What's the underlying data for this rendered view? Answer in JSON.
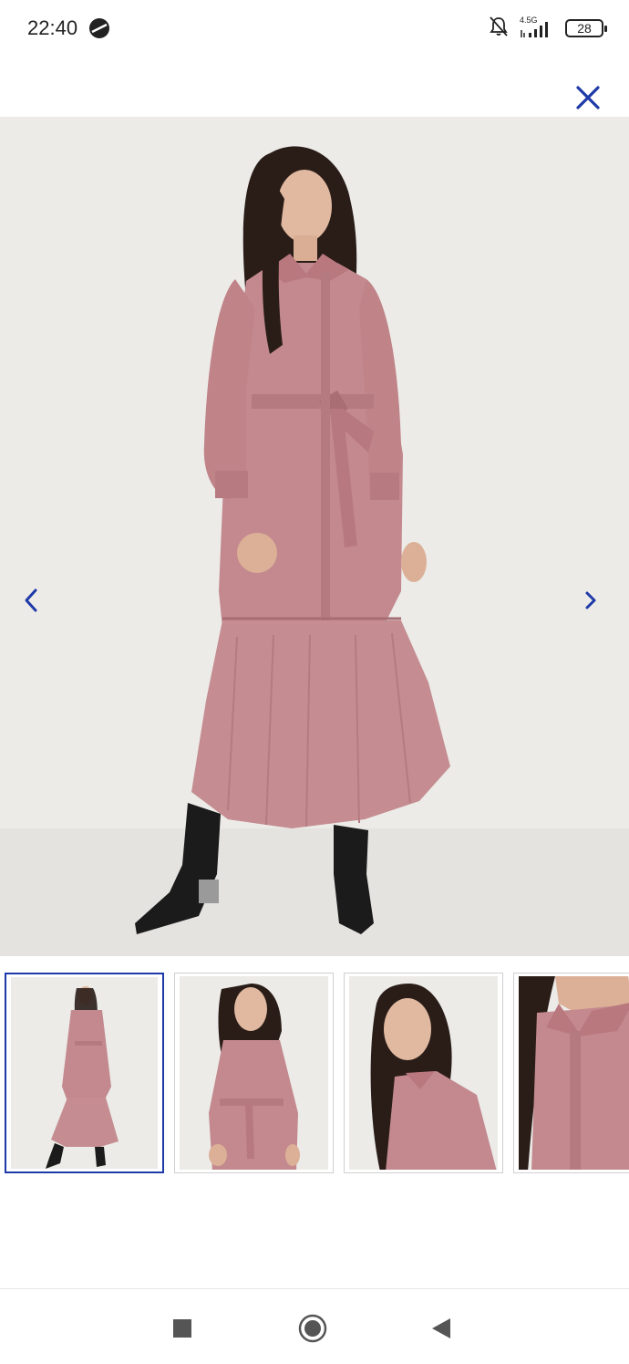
{
  "status_bar": {
    "time": "22:40",
    "network": "4.5G",
    "battery": "28",
    "icons": [
      "app-notification-icon",
      "bell-muted-icon",
      "signal-icon",
      "battery-icon"
    ]
  },
  "header": {
    "close_icon": "close-icon"
  },
  "gallery": {
    "main_image": "pink-belted-shirt-dress-full-length",
    "prev_icon": "chevron-left-icon",
    "next_icon": "chevron-right-icon",
    "thumbnails": [
      {
        "image": "full-length-front",
        "selected": true
      },
      {
        "image": "three-quarter-front",
        "selected": false
      },
      {
        "image": "upper-body-side",
        "selected": false
      },
      {
        "image": "collar-detail",
        "selected": false
      }
    ]
  },
  "colors": {
    "accent": "#1e3aa8",
    "dress": "#c08a8e",
    "background": "#e9e9e7"
  },
  "system_nav": {
    "icons": [
      "recent-apps-icon",
      "home-icon",
      "back-icon"
    ]
  }
}
